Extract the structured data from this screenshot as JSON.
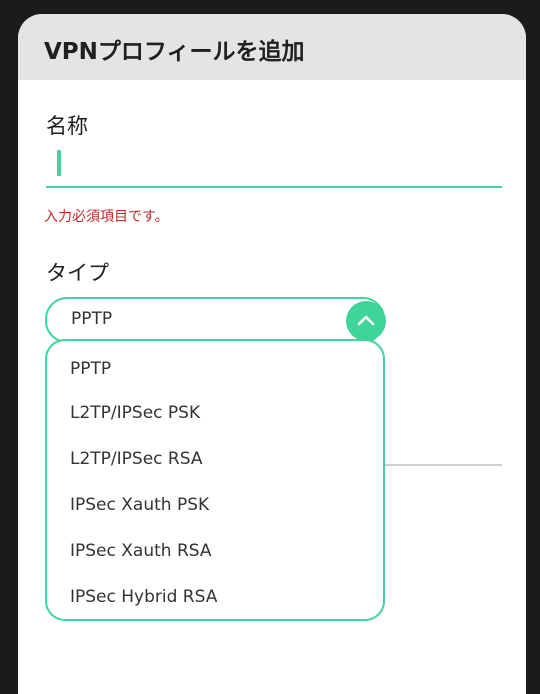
{
  "dialog": {
    "title": "VPNプロフィールを追加"
  },
  "name_field": {
    "label": "名称",
    "value": "",
    "error": "入力必須項目です。"
  },
  "type_field": {
    "label": "タイプ",
    "selected": "PPTP",
    "expanded": true,
    "options": [
      "PPTP",
      "L2TP/IPSec PSK",
      "L2TP/IPSec RSA",
      "IPSec Xauth PSK",
      "IPSec Xauth RSA",
      "IPSec Hybrid RSA"
    ]
  },
  "icons": {
    "dropdown_toggle": "chevron-up-icon"
  },
  "colors": {
    "accent": "#3fd49a",
    "error": "#c62828",
    "header_bg": "#e4e4e4"
  }
}
